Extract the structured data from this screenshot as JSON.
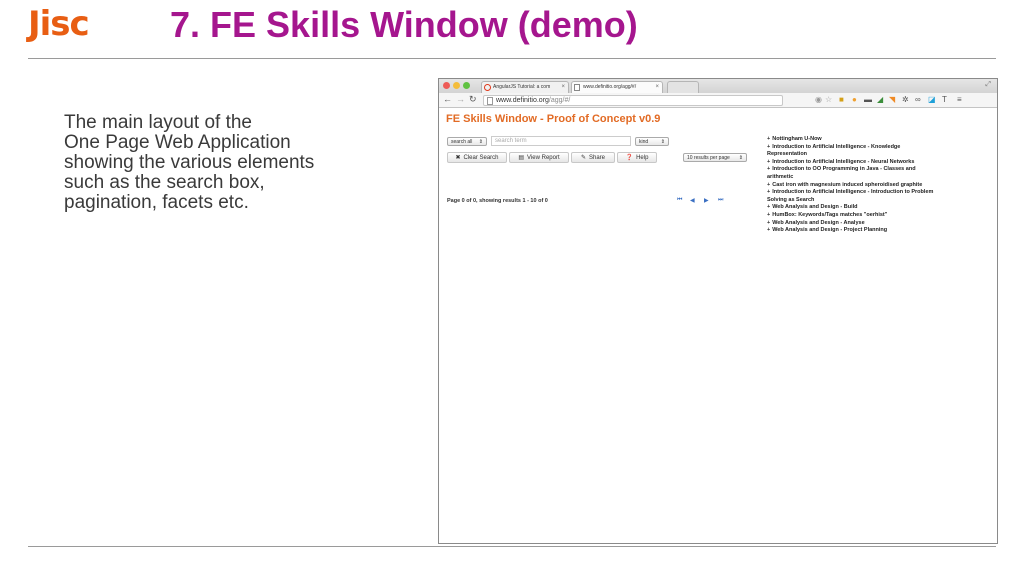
{
  "slide": {
    "logo": "Jisc",
    "title": "7. FE Skills Window (demo)",
    "body": "The main layout of the\nOne Page Web Application\nshowing the various elements\nsuch as the search box,\npagination, facets etc."
  },
  "browser": {
    "tabs": [
      {
        "label": "AngularJS Tutorial: a com",
        "close": "×"
      },
      {
        "label": "www.definitio.org/agg/#/",
        "close": "×"
      }
    ],
    "url_host": "www.definitio.org",
    "url_path": "/agg/#/",
    "icons": [
      "traffic-lights",
      "back-icon",
      "forward-icon",
      "reload-icon",
      "star-icon",
      "extension-icons",
      "menu-icon"
    ]
  },
  "app": {
    "title": "FE Skills Window - Proof of Concept v0.9",
    "search_scope": "search all",
    "search_placeholder": "search term",
    "kind_select": "kind",
    "per_page": "10 results per page",
    "buttons": {
      "clear": "Clear Search",
      "report": "View Report",
      "share": "Share",
      "help": "Help"
    },
    "pagination_text": "Page 0 of 0, showing results 1 - 10 of 0",
    "results": [
      "Nottingham U-Now",
      "Introduction to Artificial Intelligence - Knowledge Representation",
      "Introduction to Artificial Intelligence - Neural Networks",
      "Introduction to OO Programming in Java - Classes and arithmetic",
      "Cast iron with magnesium induced spheroidised graphite",
      "Introduction to Artificial Intelligence - Introduction to Problem Solving as Search",
      "Web Analysis and Design - Build",
      "HumBox: Keywords/Tags matches \"oerhist\"",
      "Web Analysis and Design - Analyse",
      "Web Analysis and Design - Project Planning"
    ]
  }
}
